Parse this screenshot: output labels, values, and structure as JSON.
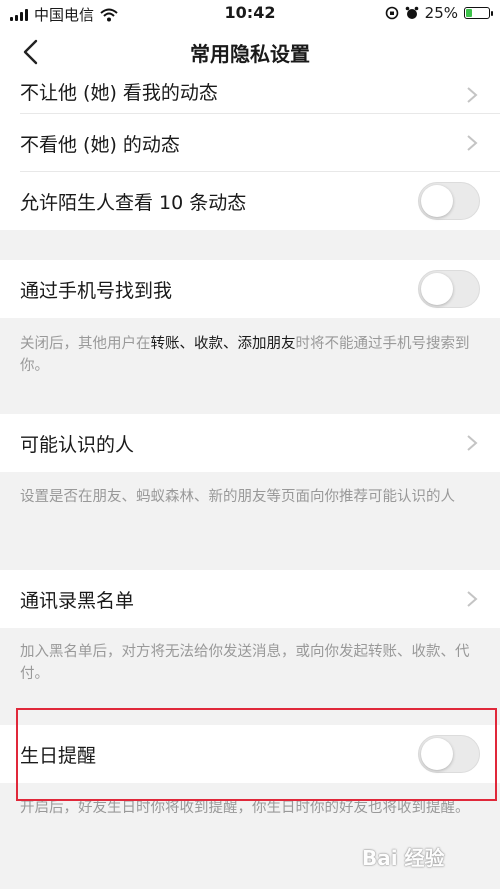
{
  "status_bar": {
    "carrier": "中国电信",
    "time": "10:42",
    "battery_percent": "25%",
    "battery_level": 0.25,
    "icons": [
      "signal-icon",
      "wifi-icon",
      "lock-rotation-icon",
      "alarm-icon",
      "battery-icon"
    ]
  },
  "header": {
    "title": "常用隐私设置",
    "back_icon": "chevron-left-icon"
  },
  "rows": {
    "hide_moments": "不让他 (她) 看我的动态",
    "not_view_moments": "不看他 (她) 的动态",
    "strangers_view": "允许陌生人查看 10 条动态",
    "find_by_phone": "通过手机号找到我",
    "people_you_may_know": "可能认识的人",
    "contacts_blacklist": "通讯录黑名单",
    "birthday_reminder": "生日提醒"
  },
  "toggles": {
    "strangers_view": false,
    "find_by_phone": false,
    "birthday_reminder": false
  },
  "notes": {
    "phone_note_prefix": "关闭后，其他用户在",
    "phone_note_highlight": "转账、收款、添加朋友",
    "phone_note_suffix": "时将不能通过手机号搜索到你。",
    "recommend_note": "设置是否在朋友、蚂蚁森林、新的朋友等页面向你推荐可能认识的人",
    "blacklist_note": "加入黑名单后，对方将无法给你发送消息，或向你发起转账、收款、代付。",
    "birthday_note": "开启后，好友生日时你将收到提醒，你生日时你的好友也将收到提醒。"
  },
  "watermark": "Bai 经验",
  "colors": {
    "highlight_border": "#e0283a",
    "toggle_off": "#eaeaea",
    "battery_fill": "#3cc24a"
  }
}
